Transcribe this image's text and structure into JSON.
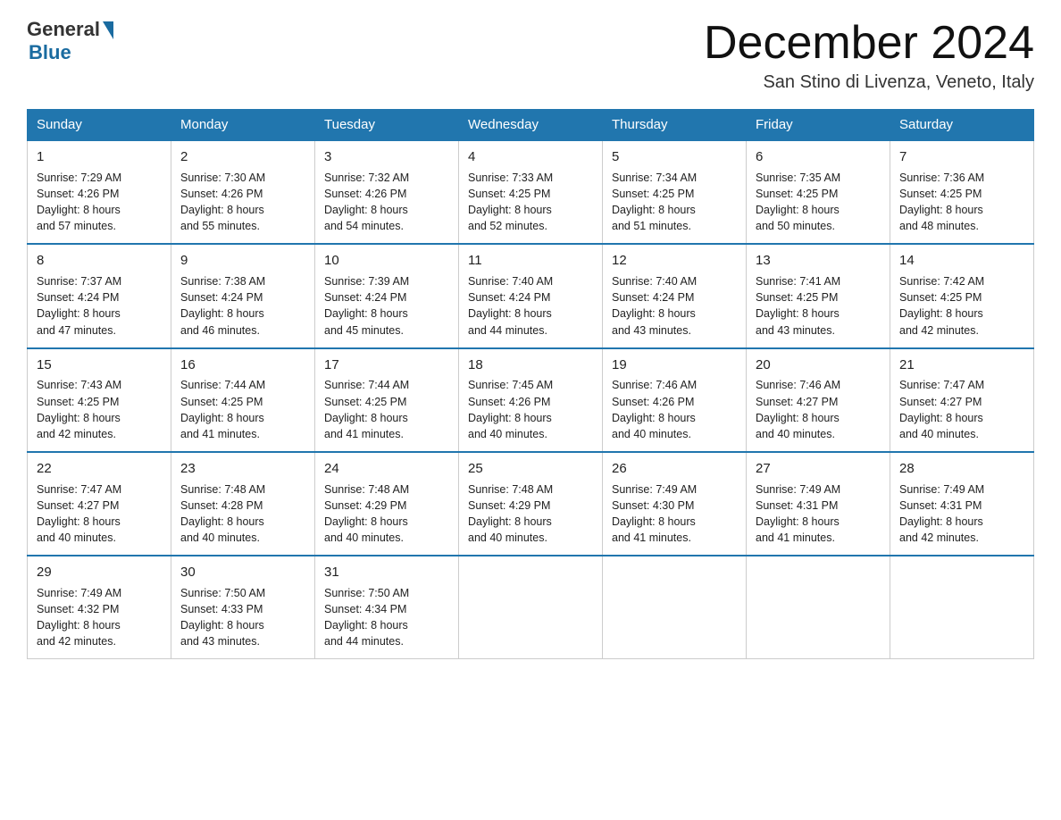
{
  "header": {
    "logo_general": "General",
    "logo_blue": "Blue",
    "title": "December 2024",
    "location": "San Stino di Livenza, Veneto, Italy"
  },
  "days_of_week": [
    "Sunday",
    "Monday",
    "Tuesday",
    "Wednesday",
    "Thursday",
    "Friday",
    "Saturday"
  ],
  "weeks": [
    [
      {
        "day": "1",
        "sunrise": "7:29 AM",
        "sunset": "4:26 PM",
        "daylight": "8 hours and 57 minutes."
      },
      {
        "day": "2",
        "sunrise": "7:30 AM",
        "sunset": "4:26 PM",
        "daylight": "8 hours and 55 minutes."
      },
      {
        "day": "3",
        "sunrise": "7:32 AM",
        "sunset": "4:26 PM",
        "daylight": "8 hours and 54 minutes."
      },
      {
        "day": "4",
        "sunrise": "7:33 AM",
        "sunset": "4:25 PM",
        "daylight": "8 hours and 52 minutes."
      },
      {
        "day": "5",
        "sunrise": "7:34 AM",
        "sunset": "4:25 PM",
        "daylight": "8 hours and 51 minutes."
      },
      {
        "day": "6",
        "sunrise": "7:35 AM",
        "sunset": "4:25 PM",
        "daylight": "8 hours and 50 minutes."
      },
      {
        "day": "7",
        "sunrise": "7:36 AM",
        "sunset": "4:25 PM",
        "daylight": "8 hours and 48 minutes."
      }
    ],
    [
      {
        "day": "8",
        "sunrise": "7:37 AM",
        "sunset": "4:24 PM",
        "daylight": "8 hours and 47 minutes."
      },
      {
        "day": "9",
        "sunrise": "7:38 AM",
        "sunset": "4:24 PM",
        "daylight": "8 hours and 46 minutes."
      },
      {
        "day": "10",
        "sunrise": "7:39 AM",
        "sunset": "4:24 PM",
        "daylight": "8 hours and 45 minutes."
      },
      {
        "day": "11",
        "sunrise": "7:40 AM",
        "sunset": "4:24 PM",
        "daylight": "8 hours and 44 minutes."
      },
      {
        "day": "12",
        "sunrise": "7:40 AM",
        "sunset": "4:24 PM",
        "daylight": "8 hours and 43 minutes."
      },
      {
        "day": "13",
        "sunrise": "7:41 AM",
        "sunset": "4:25 PM",
        "daylight": "8 hours and 43 minutes."
      },
      {
        "day": "14",
        "sunrise": "7:42 AM",
        "sunset": "4:25 PM",
        "daylight": "8 hours and 42 minutes."
      }
    ],
    [
      {
        "day": "15",
        "sunrise": "7:43 AM",
        "sunset": "4:25 PM",
        "daylight": "8 hours and 42 minutes."
      },
      {
        "day": "16",
        "sunrise": "7:44 AM",
        "sunset": "4:25 PM",
        "daylight": "8 hours and 41 minutes."
      },
      {
        "day": "17",
        "sunrise": "7:44 AM",
        "sunset": "4:25 PM",
        "daylight": "8 hours and 41 minutes."
      },
      {
        "day": "18",
        "sunrise": "7:45 AM",
        "sunset": "4:26 PM",
        "daylight": "8 hours and 40 minutes."
      },
      {
        "day": "19",
        "sunrise": "7:46 AM",
        "sunset": "4:26 PM",
        "daylight": "8 hours and 40 minutes."
      },
      {
        "day": "20",
        "sunrise": "7:46 AM",
        "sunset": "4:27 PM",
        "daylight": "8 hours and 40 minutes."
      },
      {
        "day": "21",
        "sunrise": "7:47 AM",
        "sunset": "4:27 PM",
        "daylight": "8 hours and 40 minutes."
      }
    ],
    [
      {
        "day": "22",
        "sunrise": "7:47 AM",
        "sunset": "4:27 PM",
        "daylight": "8 hours and 40 minutes."
      },
      {
        "day": "23",
        "sunrise": "7:48 AM",
        "sunset": "4:28 PM",
        "daylight": "8 hours and 40 minutes."
      },
      {
        "day": "24",
        "sunrise": "7:48 AM",
        "sunset": "4:29 PM",
        "daylight": "8 hours and 40 minutes."
      },
      {
        "day": "25",
        "sunrise": "7:48 AM",
        "sunset": "4:29 PM",
        "daylight": "8 hours and 40 minutes."
      },
      {
        "day": "26",
        "sunrise": "7:49 AM",
        "sunset": "4:30 PM",
        "daylight": "8 hours and 41 minutes."
      },
      {
        "day": "27",
        "sunrise": "7:49 AM",
        "sunset": "4:31 PM",
        "daylight": "8 hours and 41 minutes."
      },
      {
        "day": "28",
        "sunrise": "7:49 AM",
        "sunset": "4:31 PM",
        "daylight": "8 hours and 42 minutes."
      }
    ],
    [
      {
        "day": "29",
        "sunrise": "7:49 AM",
        "sunset": "4:32 PM",
        "daylight": "8 hours and 42 minutes."
      },
      {
        "day": "30",
        "sunrise": "7:50 AM",
        "sunset": "4:33 PM",
        "daylight": "8 hours and 43 minutes."
      },
      {
        "day": "31",
        "sunrise": "7:50 AM",
        "sunset": "4:34 PM",
        "daylight": "8 hours and 44 minutes."
      },
      null,
      null,
      null,
      null
    ]
  ],
  "labels": {
    "sunrise": "Sunrise:",
    "sunset": "Sunset:",
    "daylight": "Daylight:"
  }
}
